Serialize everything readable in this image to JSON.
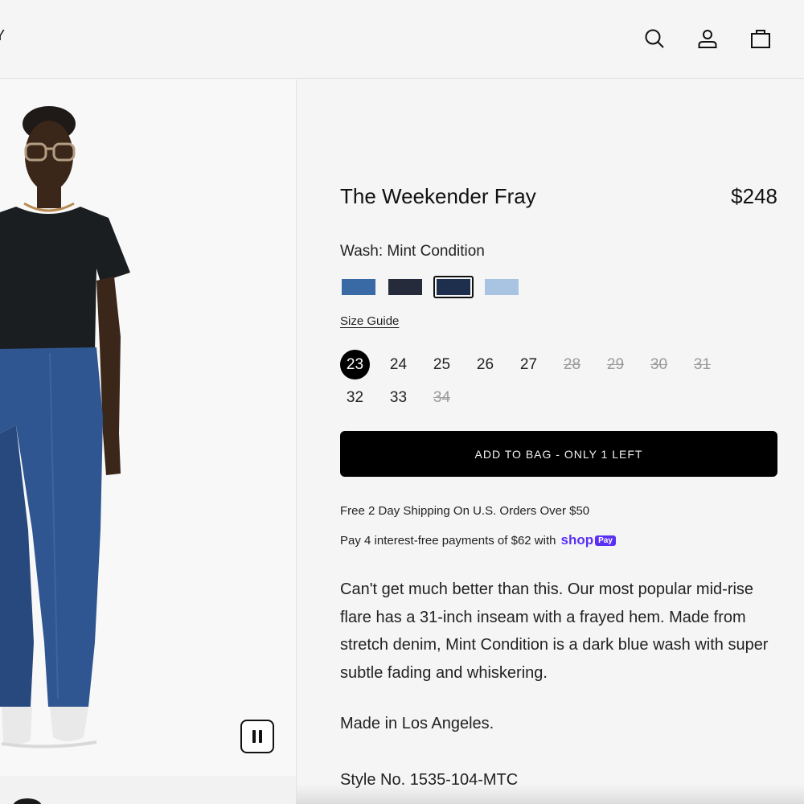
{
  "header": {
    "logo_fragment": "Y",
    "icons": [
      "search-icon",
      "account-icon",
      "bag-icon"
    ]
  },
  "media": {
    "pause_icon": "pause-icon"
  },
  "product": {
    "title": "The Weekender Fray",
    "price": "$248",
    "wash_label": "Wash: Mint Condition",
    "washes": [
      {
        "name": "wash-1",
        "color": "#3a6aa6",
        "selected": false
      },
      {
        "name": "wash-2",
        "color": "#262b3b",
        "selected": false
      },
      {
        "name": "wash-3",
        "color": "#1e2f4e",
        "selected": true
      },
      {
        "name": "wash-4",
        "color": "#a9c4e2",
        "selected": false
      }
    ],
    "size_guide": "Size Guide",
    "sizes_row1": [
      {
        "label": "23",
        "state": "selected"
      },
      {
        "label": "24",
        "state": "available"
      },
      {
        "label": "25",
        "state": "available"
      },
      {
        "label": "26",
        "state": "available"
      },
      {
        "label": "27",
        "state": "available"
      },
      {
        "label": "28",
        "state": "soldout"
      },
      {
        "label": "29",
        "state": "soldout"
      },
      {
        "label": "30",
        "state": "soldout"
      },
      {
        "label": "31",
        "state": "soldout"
      }
    ],
    "sizes_row2": [
      {
        "label": "32",
        "state": "available"
      },
      {
        "label": "33",
        "state": "available"
      },
      {
        "label": "34",
        "state": "soldout"
      }
    ],
    "add_to_bag": "ADD TO BAG - ONLY 1 LEFT",
    "shipping": "Free 2 Day Shipping On U.S. Orders Over $50",
    "pay_text": "Pay 4 interest-free payments of $62 with",
    "shop_word": "shop",
    "shop_badge": "Pay",
    "description": "Can't get much better than this. Our most popular mid-rise flare has a 31-inch inseam with a frayed hem. Made from stretch denim, Mint Condition is a dark blue wash with super subtle fading and whiskering.",
    "made_in": "Made in Los Angeles.",
    "style_no": "Style No. 1535-104-MTC"
  },
  "colors": {
    "accent": "#000000",
    "shop_pay": "#5a31f4",
    "soldout": "#9a9a9a"
  }
}
